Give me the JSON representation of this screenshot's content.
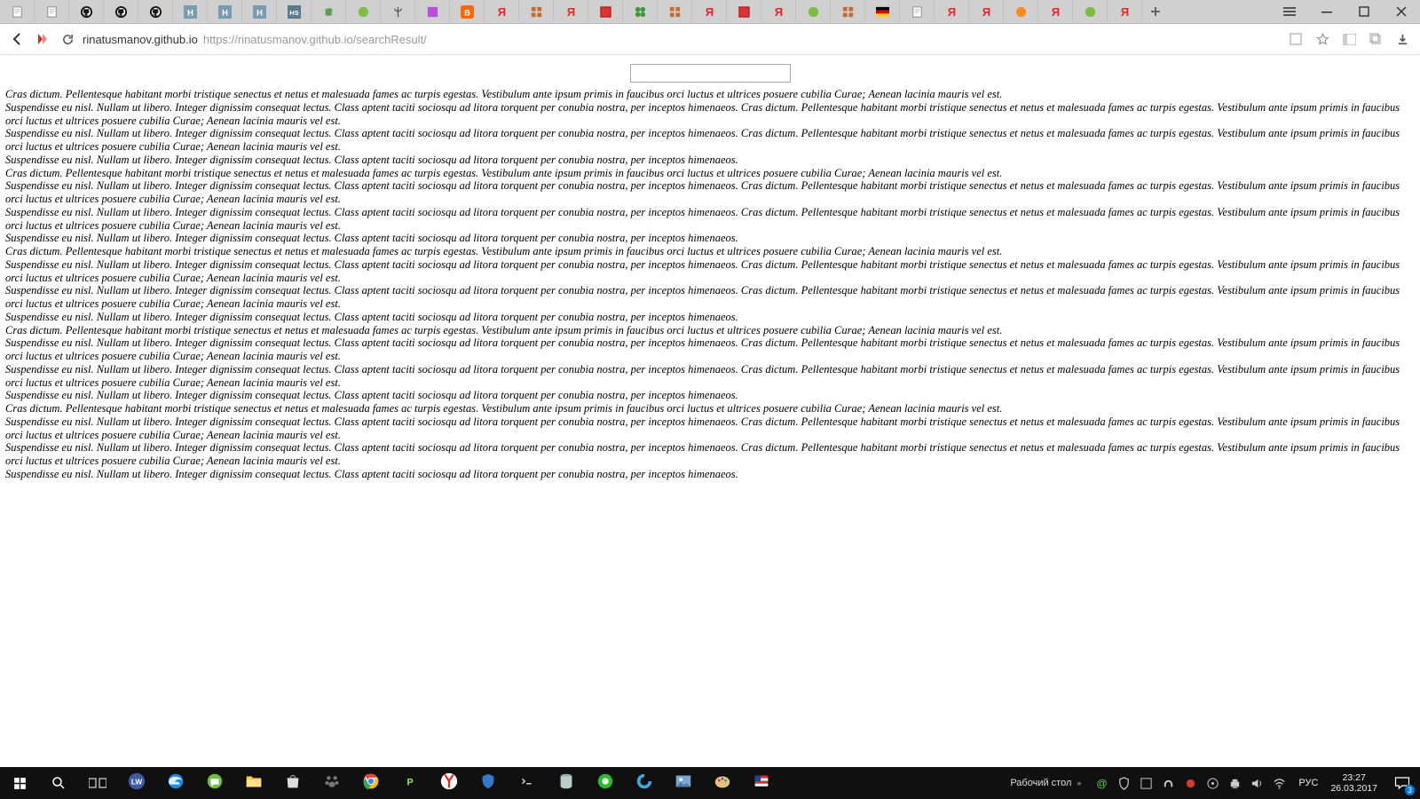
{
  "window": {
    "min": "–",
    "max": "❐",
    "close": "✕"
  },
  "addr": {
    "host": "rinatusmanov.github.io",
    "url": "https://rinatusmanov.github.io/searchResult/"
  },
  "page": {
    "search_value": "",
    "lines": [
      "Cras dictum. Pellentesque habitant morbi tristique senectus et netus et malesuada fames ac turpis egestas. Vestibulum ante ipsum primis in faucibus orci luctus et ultrices posuere cubilia Curae; Aenean lacinia mauris vel est.",
      "Suspendisse eu nisl. Nullam ut libero. Integer dignissim consequat lectus. Class aptent taciti sociosqu ad litora torquent per conubia nostra, per inceptos himenaeos. Cras dictum. Pellentesque habitant morbi tristique senectus et netus et malesuada fames ac turpis egestas. Vestibulum ante ipsum primis in faucibus orci luctus et ultrices posuere cubilia Curae; Aenean lacinia mauris vel est.",
      "Suspendisse eu nisl. Nullam ut libero. Integer dignissim consequat lectus. Class aptent taciti sociosqu ad litora torquent per conubia nostra, per inceptos himenaeos. Cras dictum. Pellentesque habitant morbi tristique senectus et netus et malesuada fames ac turpis egestas. Vestibulum ante ipsum primis in faucibus orci luctus et ultrices posuere cubilia Curae; Aenean lacinia mauris vel est.",
      "Suspendisse eu nisl. Nullam ut libero. Integer dignissim consequat lectus. Class aptent taciti sociosqu ad litora torquent per conubia nostra, per inceptos himenaeos.",
      "Cras dictum. Pellentesque habitant morbi tristique senectus et netus et malesuada fames ac turpis egestas. Vestibulum ante ipsum primis in faucibus orci luctus et ultrices posuere cubilia Curae; Aenean lacinia mauris vel est.",
      "Suspendisse eu nisl. Nullam ut libero. Integer dignissim consequat lectus. Class aptent taciti sociosqu ad litora torquent per conubia nostra, per inceptos himenaeos. Cras dictum. Pellentesque habitant morbi tristique senectus et netus et malesuada fames ac turpis egestas. Vestibulum ante ipsum primis in faucibus orci luctus et ultrices posuere cubilia Curae; Aenean lacinia mauris vel est.",
      "Suspendisse eu nisl. Nullam ut libero. Integer dignissim consequat lectus. Class aptent taciti sociosqu ad litora torquent per conubia nostra, per inceptos himenaeos. Cras dictum. Pellentesque habitant morbi tristique senectus et netus et malesuada fames ac turpis egestas. Vestibulum ante ipsum primis in faucibus orci luctus et ultrices posuere cubilia Curae; Aenean lacinia mauris vel est.",
      "Suspendisse eu nisl. Nullam ut libero. Integer dignissim consequat lectus. Class aptent taciti sociosqu ad litora torquent per conubia nostra, per inceptos himenaeos.",
      "Cras dictum. Pellentesque habitant morbi tristique senectus et netus et malesuada fames ac turpis egestas. Vestibulum ante ipsum primis in faucibus orci luctus et ultrices posuere cubilia Curae; Aenean lacinia mauris vel est.",
      "Suspendisse eu nisl. Nullam ut libero. Integer dignissim consequat lectus. Class aptent taciti sociosqu ad litora torquent per conubia nostra, per inceptos himenaeos. Cras dictum. Pellentesque habitant morbi tristique senectus et netus et malesuada fames ac turpis egestas. Vestibulum ante ipsum primis in faucibus orci luctus et ultrices posuere cubilia Curae; Aenean lacinia mauris vel est.",
      "Suspendisse eu nisl. Nullam ut libero. Integer dignissim consequat lectus. Class aptent taciti sociosqu ad litora torquent per conubia nostra, per inceptos himenaeos. Cras dictum. Pellentesque habitant morbi tristique senectus et netus et malesuada fames ac turpis egestas. Vestibulum ante ipsum primis in faucibus orci luctus et ultrices posuere cubilia Curae; Aenean lacinia mauris vel est.",
      "Suspendisse eu nisl. Nullam ut libero. Integer dignissim consequat lectus. Class aptent taciti sociosqu ad litora torquent per conubia nostra, per inceptos himenaeos.",
      "Cras dictum. Pellentesque habitant morbi tristique senectus et netus et malesuada fames ac turpis egestas. Vestibulum ante ipsum primis in faucibus orci luctus et ultrices posuere cubilia Curae; Aenean lacinia mauris vel est.",
      "Suspendisse eu nisl. Nullam ut libero. Integer dignissim consequat lectus. Class aptent taciti sociosqu ad litora torquent per conubia nostra, per inceptos himenaeos. Cras dictum. Pellentesque habitant morbi tristique senectus et netus et malesuada fames ac turpis egestas. Vestibulum ante ipsum primis in faucibus orci luctus et ultrices posuere cubilia Curae; Aenean lacinia mauris vel est.",
      "Suspendisse eu nisl. Nullam ut libero. Integer dignissim consequat lectus. Class aptent taciti sociosqu ad litora torquent per conubia nostra, per inceptos himenaeos. Cras dictum. Pellentesque habitant morbi tristique senectus et netus et malesuada fames ac turpis egestas. Vestibulum ante ipsum primis in faucibus orci luctus et ultrices posuere cubilia Curae; Aenean lacinia mauris vel est.",
      "Suspendisse eu nisl. Nullam ut libero. Integer dignissim consequat lectus. Class aptent taciti sociosqu ad litora torquent per conubia nostra, per inceptos himenaeos.",
      "Cras dictum. Pellentesque habitant morbi tristique senectus et netus et malesuada fames ac turpis egestas. Vestibulum ante ipsum primis in faucibus orci luctus et ultrices posuere cubilia Curae; Aenean lacinia mauris vel est.",
      "Suspendisse eu nisl. Nullam ut libero. Integer dignissim consequat lectus. Class aptent taciti sociosqu ad litora torquent per conubia nostra, per inceptos himenaeos. Cras dictum. Pellentesque habitant morbi tristique senectus et netus et malesuada fames ac turpis egestas. Vestibulum ante ipsum primis in faucibus orci luctus et ultrices posuere cubilia Curae; Aenean lacinia mauris vel est.",
      "Suspendisse eu nisl. Nullam ut libero. Integer dignissim consequat lectus. Class aptent taciti sociosqu ad litora torquent per conubia nostra, per inceptos himenaeos. Cras dictum. Pellentesque habitant morbi tristique senectus et netus et malesuada fames ac turpis egestas. Vestibulum ante ipsum primis in faucibus orci luctus et ultrices posuere cubilia Curae; Aenean lacinia mauris vel est.",
      "Suspendisse eu nisl. Nullam ut libero. Integer dignissim consequat lectus. Class aptent taciti sociosqu ad litora torquent per conubia nostra, per inceptos himenaeos."
    ]
  },
  "tabs": [
    {
      "icon": "page"
    },
    {
      "icon": "page"
    },
    {
      "icon": "github"
    },
    {
      "icon": "github"
    },
    {
      "icon": "github"
    },
    {
      "icon": "habr",
      "t": "H"
    },
    {
      "icon": "habr",
      "t": "H"
    },
    {
      "icon": "habr",
      "t": "H"
    },
    {
      "icon": "hs",
      "t": "HS"
    },
    {
      "icon": "puzzle"
    },
    {
      "icon": "green"
    },
    {
      "icon": "trident"
    },
    {
      "icon": "purple"
    },
    {
      "icon": "blogger"
    },
    {
      "icon": "yandex"
    },
    {
      "icon": "grid"
    },
    {
      "icon": "yandex"
    },
    {
      "icon": "redbox"
    },
    {
      "icon": "clover"
    },
    {
      "icon": "grid"
    },
    {
      "icon": "yandex"
    },
    {
      "icon": "redbox"
    },
    {
      "icon": "yandex"
    },
    {
      "icon": "green"
    },
    {
      "icon": "grid"
    },
    {
      "icon": "de"
    },
    {
      "icon": "page"
    },
    {
      "icon": "yandex"
    },
    {
      "icon": "yandex"
    },
    {
      "icon": "orange"
    },
    {
      "icon": "yandex"
    },
    {
      "icon": "green"
    },
    {
      "icon": "yandex"
    }
  ],
  "taskbar": {
    "desktop_label": "Рабочий стол",
    "lang": "РУС",
    "time": "23:27",
    "date": "26.03.2017",
    "notif_count": "3",
    "apps": [
      "logo-lw",
      "edge",
      "chat",
      "files",
      "store",
      "paw",
      "chrome",
      "p-app",
      "y-browser",
      "shield",
      "terminal",
      "db",
      "green-circle",
      "c-app",
      "photos",
      "paint",
      "flag"
    ],
    "tray": [
      "at",
      "shield-tray",
      "square",
      "headset",
      "red-circle",
      "disc",
      "printer",
      "speaker",
      "wifi"
    ]
  }
}
